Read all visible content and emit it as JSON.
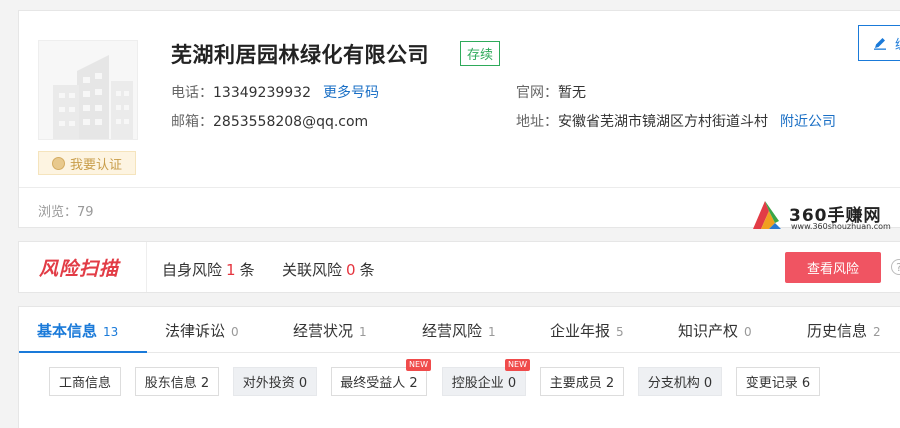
{
  "company": {
    "name": "芜湖利居园林绿化有限公司",
    "status": "存续",
    "verify_label": "我要认证",
    "phone_label": "电话：",
    "phone": "13349239932",
    "more_phones": "更多号码",
    "website_label": "官网：",
    "website": "暂无",
    "email_label": "邮箱：",
    "email": "2853558208@qq.com",
    "address_label": "地址：",
    "address": "安徽省芜湖市镜湖区方村街道斗村",
    "nearby_link": "附近公司",
    "edit_label": "编",
    "views_label": "浏览：",
    "views": "79"
  },
  "watermark": {
    "text": "360手赚网",
    "url": "www.360shouzhuan.com"
  },
  "risk": {
    "logo_text": "风险扫描",
    "self_label": "自身风险",
    "self_count": "1",
    "self_unit": "条",
    "related_label": "关联风险",
    "related_count": "0",
    "related_unit": "条",
    "button_label": "查看风险",
    "help_glyph": "?"
  },
  "tabs": [
    {
      "label": "基本信息",
      "count": "13"
    },
    {
      "label": "法律诉讼",
      "count": "0"
    },
    {
      "label": "经营状况",
      "count": "1"
    },
    {
      "label": "经营风险",
      "count": "1"
    },
    {
      "label": "企业年报",
      "count": "5"
    },
    {
      "label": "知识产权",
      "count": "0"
    },
    {
      "label": "历史信息",
      "count": "2"
    }
  ],
  "subtabs": [
    {
      "label": "工商信息"
    },
    {
      "label": "股东信息 2"
    },
    {
      "label": "对外投资 0"
    },
    {
      "label": "最终受益人 2",
      "badge": "NEW"
    },
    {
      "label": "控股企业 0",
      "badge": "NEW"
    },
    {
      "label": "主要成员 2"
    },
    {
      "label": "分支机构 0"
    },
    {
      "label": "变更记录 6"
    }
  ],
  "colors": {
    "accent": "#1a7ad9",
    "danger": "#f05462",
    "status_green": "#2eaa5a"
  },
  "icons": {
    "logo": "building-icon",
    "verify": "coin-icon",
    "edit": "pencil-icon",
    "help": "question-icon"
  }
}
